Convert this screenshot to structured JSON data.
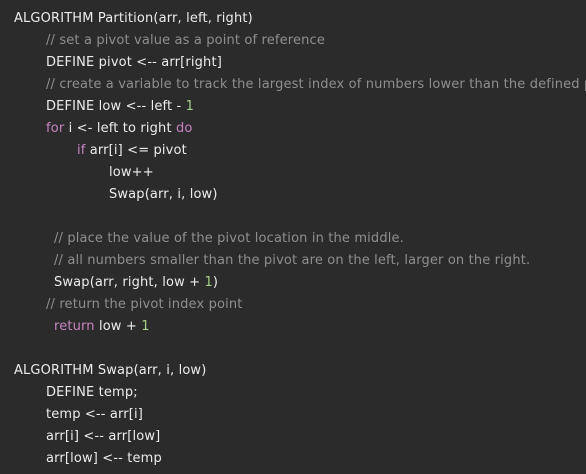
{
  "theme": {
    "background": "#2b2b2b",
    "text_color": "#ececec",
    "comment_color": "#8f8f8f",
    "keyword_color": "#c485bf",
    "number_color": "#a5cf8a"
  },
  "code": {
    "lines": [
      {
        "indent": 0,
        "tokens": [
          {
            "t": "text",
            "v": "ALGORITHM Partition(arr, left, right)"
          }
        ]
      },
      {
        "indent": 32,
        "tokens": [
          {
            "t": "comment",
            "v": "// set a pivot value as a point of reference"
          }
        ]
      },
      {
        "indent": 32,
        "tokens": [
          {
            "t": "text",
            "v": "DEFINE pivot <-- arr[right]"
          }
        ]
      },
      {
        "indent": 32,
        "tokens": [
          {
            "t": "comment",
            "v": "// create a variable to track the largest index of numbers lower than the defined pivot"
          }
        ]
      },
      {
        "indent": 32,
        "tokens": [
          {
            "t": "text",
            "v": "DEFINE low <-- left - "
          },
          {
            "t": "number",
            "v": "1"
          }
        ]
      },
      {
        "indent": 32,
        "tokens": [
          {
            "t": "keyword",
            "v": "for"
          },
          {
            "t": "text",
            "v": " i <- left to right "
          },
          {
            "t": "keyword",
            "v": "do"
          }
        ]
      },
      {
        "indent": 63,
        "tokens": [
          {
            "t": "keyword",
            "v": "if"
          },
          {
            "t": "text",
            "v": " arr[i] <= pivot"
          }
        ]
      },
      {
        "indent": 95,
        "tokens": [
          {
            "t": "text",
            "v": "low++"
          }
        ]
      },
      {
        "indent": 95,
        "tokens": [
          {
            "t": "text",
            "v": "Swap(arr, i, low)"
          }
        ]
      },
      {
        "indent": 0,
        "tokens": []
      },
      {
        "indent": 40,
        "tokens": [
          {
            "t": "comment",
            "v": "// place the value of the pivot location in the middle."
          }
        ]
      },
      {
        "indent": 40,
        "tokens": [
          {
            "t": "comment",
            "v": "// all numbers smaller than the pivot are on the left, larger on the right."
          }
        ]
      },
      {
        "indent": 40,
        "tokens": [
          {
            "t": "text",
            "v": "Swap(arr, right, low + "
          },
          {
            "t": "number",
            "v": "1"
          },
          {
            "t": "text",
            "v": ")"
          }
        ]
      },
      {
        "indent": 32,
        "tokens": [
          {
            "t": "comment",
            "v": "// return the pivot index point"
          }
        ]
      },
      {
        "indent": 40,
        "tokens": [
          {
            "t": "keyword",
            "v": "return"
          },
          {
            "t": "text",
            "v": " low + "
          },
          {
            "t": "number",
            "v": "1"
          }
        ]
      },
      {
        "indent": 0,
        "tokens": []
      },
      {
        "indent": 0,
        "tokens": [
          {
            "t": "text",
            "v": "ALGORITHM Swap(arr, i, low)"
          }
        ]
      },
      {
        "indent": 32,
        "tokens": [
          {
            "t": "text",
            "v": "DEFINE temp;"
          }
        ]
      },
      {
        "indent": 32,
        "tokens": [
          {
            "t": "text",
            "v": "temp <-- arr[i]"
          }
        ]
      },
      {
        "indent": 32,
        "tokens": [
          {
            "t": "text",
            "v": "arr[i] <-- arr[low]"
          }
        ]
      },
      {
        "indent": 32,
        "tokens": [
          {
            "t": "text",
            "v": "arr[low] <-- temp"
          }
        ]
      }
    ]
  }
}
